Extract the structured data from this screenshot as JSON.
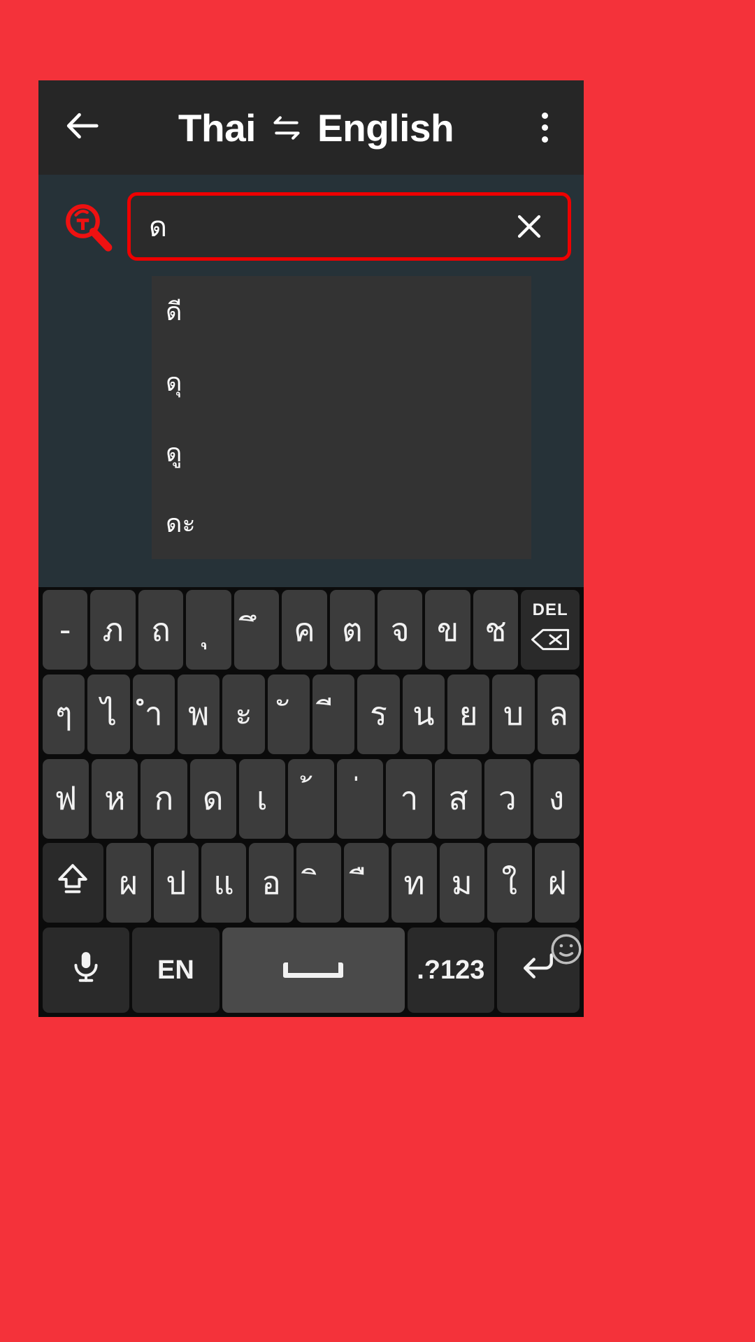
{
  "theme": {
    "page_background": "#f4323a",
    "appbar_background": "#262626",
    "search_background": "#263238",
    "highlight_outline": "#ee0000",
    "keyboard_background": "#0b0b0b",
    "key_background": "#3c3c3c"
  },
  "appbar": {
    "back_icon": "arrow-left-icon",
    "source_language": "Thai",
    "swap_icon": "swap-horizontal-icon",
    "target_language": "English",
    "overflow_icon": "more-vertical-icon"
  },
  "search": {
    "icon": "thai-search-icon",
    "value": "ด",
    "placeholder": "",
    "clear_icon": "close-icon"
  },
  "suggestions": [
    {
      "label": "ดี"
    },
    {
      "label": "ดุ"
    },
    {
      "label": "ดู"
    },
    {
      "label": "ดะ"
    }
  ],
  "keyboard": {
    "language_label": "EN",
    "rows": [
      {
        "name": "row-1",
        "keys": [
          {
            "name": "key-hyphen",
            "label": "-"
          },
          {
            "name": "key-pho-sampao",
            "label": "ภ"
          },
          {
            "name": "key-tho-thung",
            "label": "ถ"
          },
          {
            "name": "key-sara-u",
            "label": "ุ"
          },
          {
            "name": "key-sara-uee",
            "label": "ึ"
          },
          {
            "name": "key-kho-khwai",
            "label": "ค"
          },
          {
            "name": "key-to-tao",
            "label": "ต"
          },
          {
            "name": "key-cho-chan",
            "label": "จ"
          },
          {
            "name": "key-kho-khai",
            "label": "ข"
          },
          {
            "name": "key-cho-chang",
            "label": "ช"
          },
          {
            "name": "key-delete",
            "label": "DEL",
            "icon": "backspace-icon",
            "style": "dark"
          }
        ]
      },
      {
        "name": "row-2",
        "keys": [
          {
            "name": "key-paiyannoi",
            "label": "ๆ"
          },
          {
            "name": "key-sara-ai-maimalai",
            "label": "ไ"
          },
          {
            "name": "key-sara-am",
            "label": "ำ"
          },
          {
            "name": "key-pho-phan",
            "label": "พ"
          },
          {
            "name": "key-sara-a",
            "label": "ะ"
          },
          {
            "name": "key-sara-i",
            "label": "ั"
          },
          {
            "name": "key-mai-tho",
            "label": "ี"
          },
          {
            "name": "key-ro-rua",
            "label": "ร"
          },
          {
            "name": "key-no-nu",
            "label": "น"
          },
          {
            "name": "key-yo-yak",
            "label": "ย"
          },
          {
            "name": "key-bo-baimai",
            "label": "บ"
          },
          {
            "name": "key-lo-ling",
            "label": "ล"
          }
        ]
      },
      {
        "name": "row-3",
        "keys": [
          {
            "name": "key-fo-fan",
            "label": "ฟ"
          },
          {
            "name": "key-ho-hip",
            "label": "ห"
          },
          {
            "name": "key-ko-kai",
            "label": "ก"
          },
          {
            "name": "key-do-dek",
            "label": "ด"
          },
          {
            "name": "key-sara-e",
            "label": "เ"
          },
          {
            "name": "key-mai-tho-upper",
            "label": "้"
          },
          {
            "name": "key-mai-ek",
            "label": "่"
          },
          {
            "name": "key-sara-aa",
            "label": "า"
          },
          {
            "name": "key-so-sua",
            "label": "ส"
          },
          {
            "name": "key-wo-waen",
            "label": "ว"
          },
          {
            "name": "key-ngo-ngu",
            "label": "ง"
          }
        ]
      },
      {
        "name": "row-4",
        "keys": [
          {
            "name": "key-shift",
            "label": "",
            "icon": "shift-icon",
            "style": "dark"
          },
          {
            "name": "key-pho-phung",
            "label": "ผ"
          },
          {
            "name": "key-po-pla",
            "label": "ป"
          },
          {
            "name": "key-sara-ae",
            "label": "แ"
          },
          {
            "name": "key-o-ang",
            "label": "อ"
          },
          {
            "name": "key-sara-ii",
            "label": "ิ"
          },
          {
            "name": "key-sara-ue",
            "label": "ื"
          },
          {
            "name": "key-tho-thahan",
            "label": "ท"
          },
          {
            "name": "key-mo-ma",
            "label": "ม"
          },
          {
            "name": "key-sara-ai-maimuan",
            "label": "ใ"
          },
          {
            "name": "key-fo-fa",
            "label": "ฝ"
          }
        ]
      }
    ],
    "bottom_row": {
      "name": "row-bottom",
      "keys": [
        {
          "name": "key-voice-input",
          "label": "",
          "icon": "microphone-icon",
          "style": "dark"
        },
        {
          "name": "key-language-switch",
          "label": "EN",
          "style": "dark"
        },
        {
          "name": "key-space",
          "label": "",
          "icon": "space-icon"
        },
        {
          "name": "key-symbols",
          "label": ".?123",
          "style": "dark"
        },
        {
          "name": "key-enter",
          "label": "",
          "icon": "enter-icon",
          "badge": "emoji-icon",
          "style": "dark"
        }
      ]
    }
  }
}
